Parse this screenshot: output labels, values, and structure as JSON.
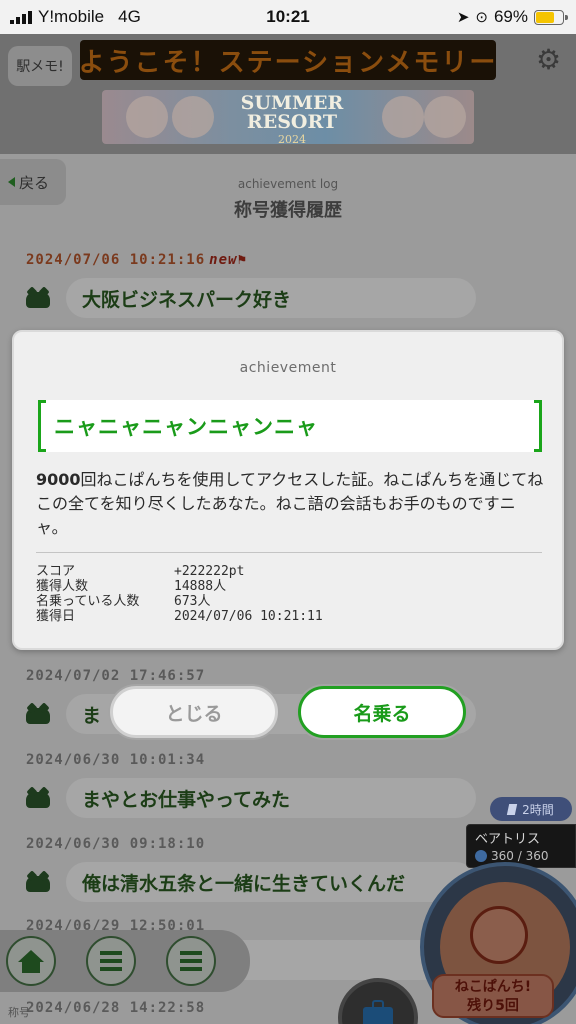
{
  "status_bar": {
    "carrier": "Y!mobile",
    "network": "4G",
    "time": "10:21",
    "battery": "69%",
    "battery_level": 0.69
  },
  "header": {
    "logo": "駅メモ!",
    "marquee": "ようこそ！ステーションメモリー",
    "settings_icon": "gear-icon",
    "banner": {
      "line1": "SUMMER",
      "line2": "RESORT",
      "year": "2024"
    }
  },
  "nav_back": "戻る",
  "log": {
    "subtitle": "achievement log",
    "title": "称号獲得履歴",
    "entries": [
      {
        "date": "2024/07/06 10:21:16",
        "is_new": true,
        "new_label": "new",
        "title": "大阪ビジネスパーク好き"
      },
      {
        "date": "2024/07/02 17:46:57",
        "is_new": false,
        "title": "ま"
      },
      {
        "date": "2024/06/30 10:01:34",
        "is_new": false,
        "title": "まやとお仕事やってみた"
      },
      {
        "date": "2024/06/30 09:18:10",
        "is_new": false,
        "title": "俺は清水五条と一緒に生きていくんだ"
      },
      {
        "date": "2024/06/29 12:50:01",
        "is_new": false,
        "title": ""
      },
      {
        "date": "2024/06/28 14:22:58",
        "is_new": false,
        "title": ""
      }
    ]
  },
  "time_badge": "2時間",
  "character": {
    "name": "ベアトリス",
    "hp": "360 / 360",
    "action": "ねこぱんち!",
    "remaining": "残り5回"
  },
  "bottom_label": "称号",
  "modal": {
    "caption": "achievement",
    "title": "ニャニャニャンニャンニャ",
    "description_number": "9000",
    "description": "回ねこぱんちを使用してアクセスした証。ねこぱんちを通じてねこの全てを知り尽くしたあなた。ねこ語の会話もお手のものですニャ。",
    "stats": [
      {
        "label": "スコア",
        "value": "+222222pt"
      },
      {
        "label": "獲得人数",
        "value": "14888人"
      },
      {
        "label": "名乗っている人数",
        "value": "673人"
      },
      {
        "label": "獲得日",
        "value": "2024/07/06 10:21:11"
      }
    ]
  },
  "buttons": {
    "close": "とじる",
    "use_title": "名乗る"
  },
  "colors": {
    "accent_green": "#1a9b1a",
    "battery_yellow": "#f5c400",
    "overlay": "#8a8a8a"
  }
}
